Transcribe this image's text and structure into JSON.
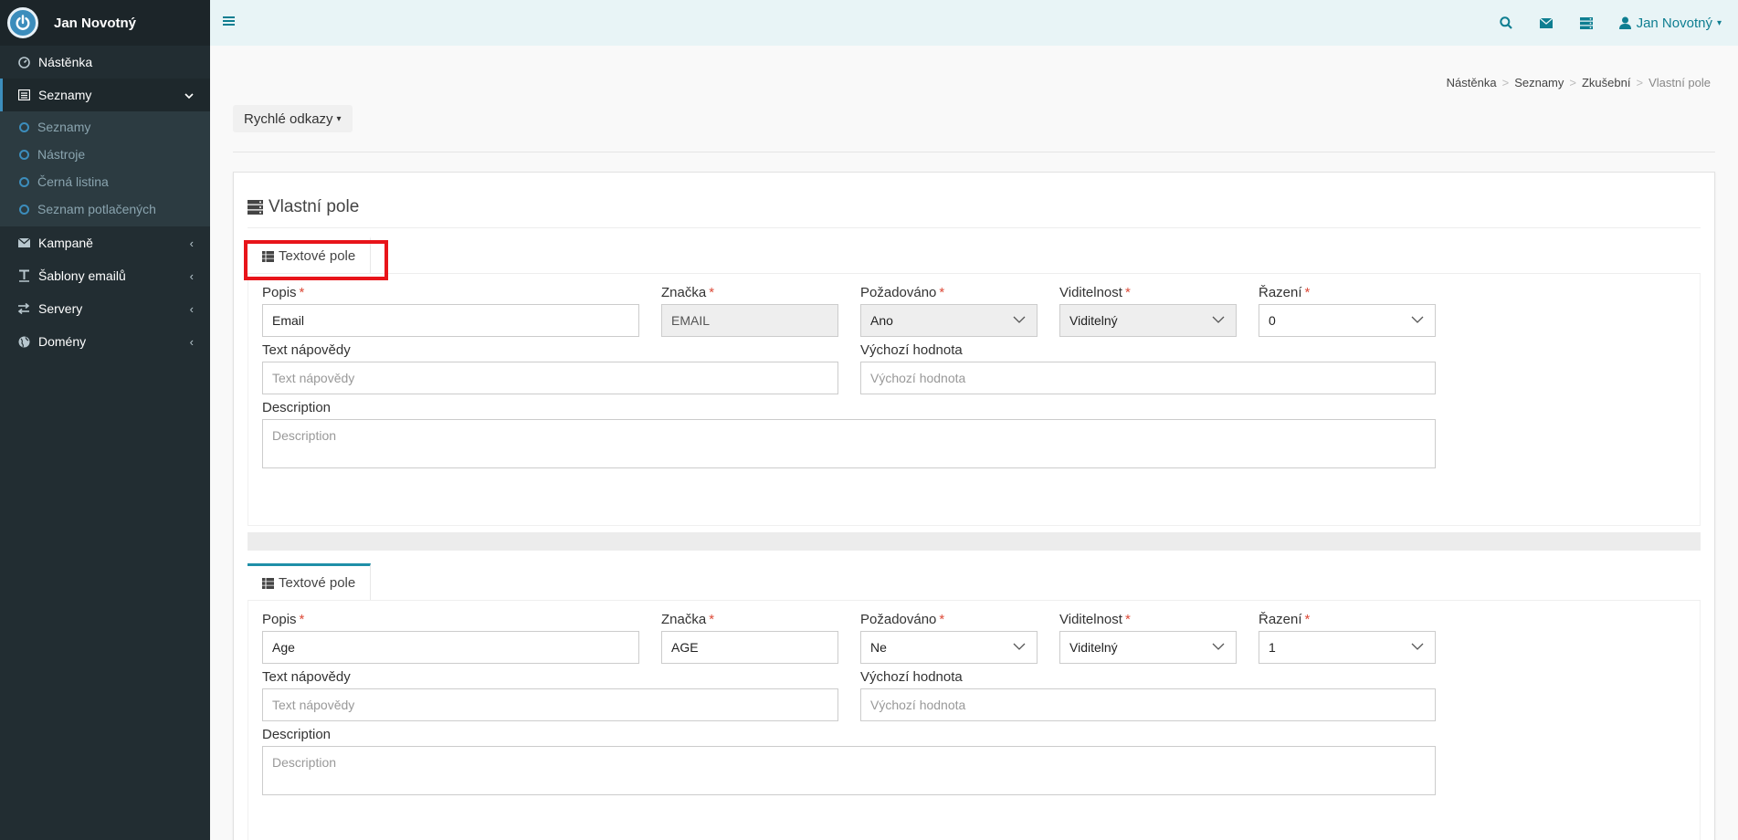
{
  "brand": {
    "name": "Jan Novotný"
  },
  "sidebar": {
    "items": [
      {
        "label": "Nástěnka",
        "icon": "dashboard-icon"
      },
      {
        "label": "Seznamy",
        "icon": "list-icon",
        "active": true
      },
      {
        "label": "Kampaně",
        "icon": "envelope-icon"
      },
      {
        "label": "Šablony emailů",
        "icon": "text-icon"
      },
      {
        "label": "Servery",
        "icon": "exchange-icon"
      },
      {
        "label": "Domény",
        "icon": "globe-icon"
      }
    ],
    "subitems": [
      {
        "label": "Seznamy"
      },
      {
        "label": "Nástroje"
      },
      {
        "label": "Černá listina"
      },
      {
        "label": "Seznam potlačených"
      }
    ]
  },
  "topbar": {
    "user": "Jan Novotný"
  },
  "breadcrumb": [
    "Nástěnka",
    "Seznamy",
    "Zkušební",
    "Vlastní pole"
  ],
  "quick_links": "Rychlé odkazy",
  "box": {
    "title": "Vlastní pole"
  },
  "labels": {
    "popis": "Popis",
    "znacka": "Značka",
    "pozadovano": "Požadováno",
    "viditelnost": "Viditelnost",
    "razeni": "Řazení",
    "napoveda": "Text nápovědy",
    "vychozi": "Výchozí hodnota",
    "description": "Description",
    "req": "*"
  },
  "fields": [
    {
      "tab": "Textové pole",
      "popis": "Email",
      "znacka": "EMAIL",
      "pozadovano": "Ano",
      "viditelnost": "Viditelný",
      "razeni": "0",
      "napoveda_placeholder": "Text nápovědy",
      "vychozi_placeholder": "Výchozí hodnota",
      "description_placeholder": "Description"
    },
    {
      "tab": "Textové pole",
      "popis": "Age",
      "znacka": "AGE",
      "pozadovano": "Ne",
      "viditelnost": "Viditelný",
      "razeni": "1",
      "napoveda_placeholder": "Text nápovědy",
      "vychozi_placeholder": "Výchozí hodnota",
      "description_placeholder": "Description"
    }
  ],
  "colors": {
    "sidebar_bg": "#222d32",
    "accent": "#0e7e91",
    "highlight": "#e8141a",
    "required": "#dd4b39"
  }
}
